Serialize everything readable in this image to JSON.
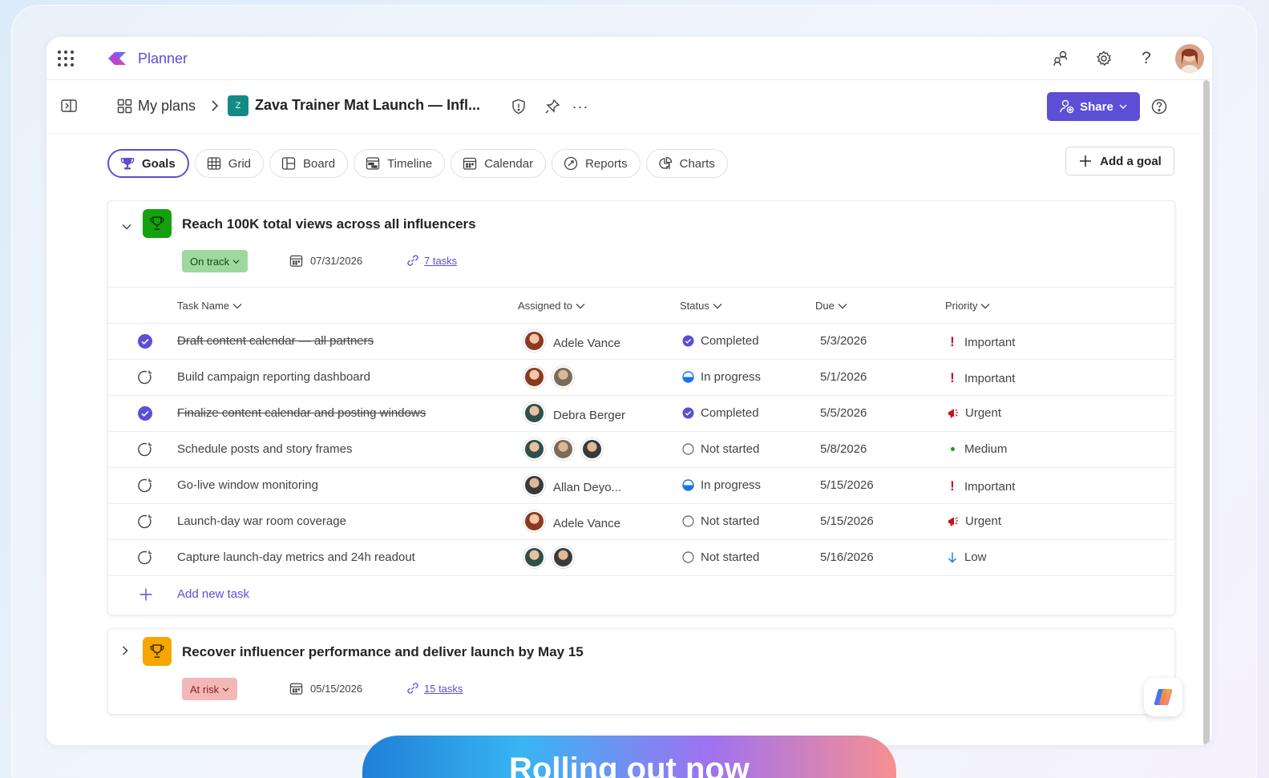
{
  "app": {
    "name": "Planner"
  },
  "header": {
    "breadcrumb_root": "My plans",
    "plan_badge": "Z",
    "plan_title": "Zava Trainer Mat Launch — Infl...",
    "share_label": "Share"
  },
  "tabs": [
    {
      "label": "Goals",
      "icon": "trophy-icon",
      "active": true
    },
    {
      "label": "Grid",
      "icon": "grid-icon"
    },
    {
      "label": "Board",
      "icon": "board-icon"
    },
    {
      "label": "Timeline",
      "icon": "timeline-icon"
    },
    {
      "label": "Calendar",
      "icon": "calendar-icon"
    },
    {
      "label": "Reports",
      "icon": "reports-icon"
    },
    {
      "label": "Charts",
      "icon": "charts-icon"
    }
  ],
  "add_goal_label": "Add a goal",
  "goals": [
    {
      "title": "Reach 100K total views across all influencers",
      "status": "On track",
      "status_color": "#9fd89f",
      "date": "07/31/2026",
      "tasks_link": "7 tasks",
      "expanded": true
    },
    {
      "title": "Recover influencer performance and deliver launch by May 15",
      "status": "At risk",
      "status_color": "#f4b7b7",
      "date": "05/15/2026",
      "tasks_link": "15 tasks",
      "expanded": false
    }
  ],
  "table": {
    "headers": {
      "task": "Task Name",
      "assigned": "Assigned to",
      "status": "Status",
      "due": "Due",
      "priority": "Priority"
    },
    "rows": [
      {
        "task": "Draft content calendar — all partners",
        "done": true,
        "assignee": "Adele Vance",
        "status": "Completed",
        "due": "5/3/2026",
        "priority": "Important"
      },
      {
        "task": "Build campaign reporting dashboard",
        "done": false,
        "assignee": "",
        "status": "In progress",
        "due": "5/1/2026",
        "priority": "Important"
      },
      {
        "task": "Finalize content calendar and posting windows",
        "done": true,
        "assignee": "Debra Berger",
        "status": "Completed",
        "due": "5/5/2026",
        "priority": "Urgent"
      },
      {
        "task": "Schedule posts and story frames",
        "done": false,
        "assignee": "",
        "status": "Not started",
        "due": "5/8/2026",
        "priority": "Medium"
      },
      {
        "task": "Go-live window monitoring",
        "done": false,
        "assignee": "Allan Deyo...",
        "status": "In progress",
        "due": "5/15/2026",
        "priority": "Important"
      },
      {
        "task": "Launch-day war room coverage",
        "done": false,
        "assignee": "Adele Vance",
        "status": "Not started",
        "due": "5/15/2026",
        "priority": "Urgent"
      },
      {
        "task": "Capture launch-day metrics and 24h readout",
        "done": false,
        "assignee": "",
        "status": "Not started",
        "due": "5/16/2026",
        "priority": "Low"
      }
    ],
    "add_task_label": "Add new task"
  },
  "banner": {
    "text": "Rolling out now"
  },
  "colors": {
    "accent": "#5b4fd6",
    "on_track_green": "#13a10e",
    "at_risk_amber": "#f7a600",
    "important_red": "#c50f1f"
  }
}
